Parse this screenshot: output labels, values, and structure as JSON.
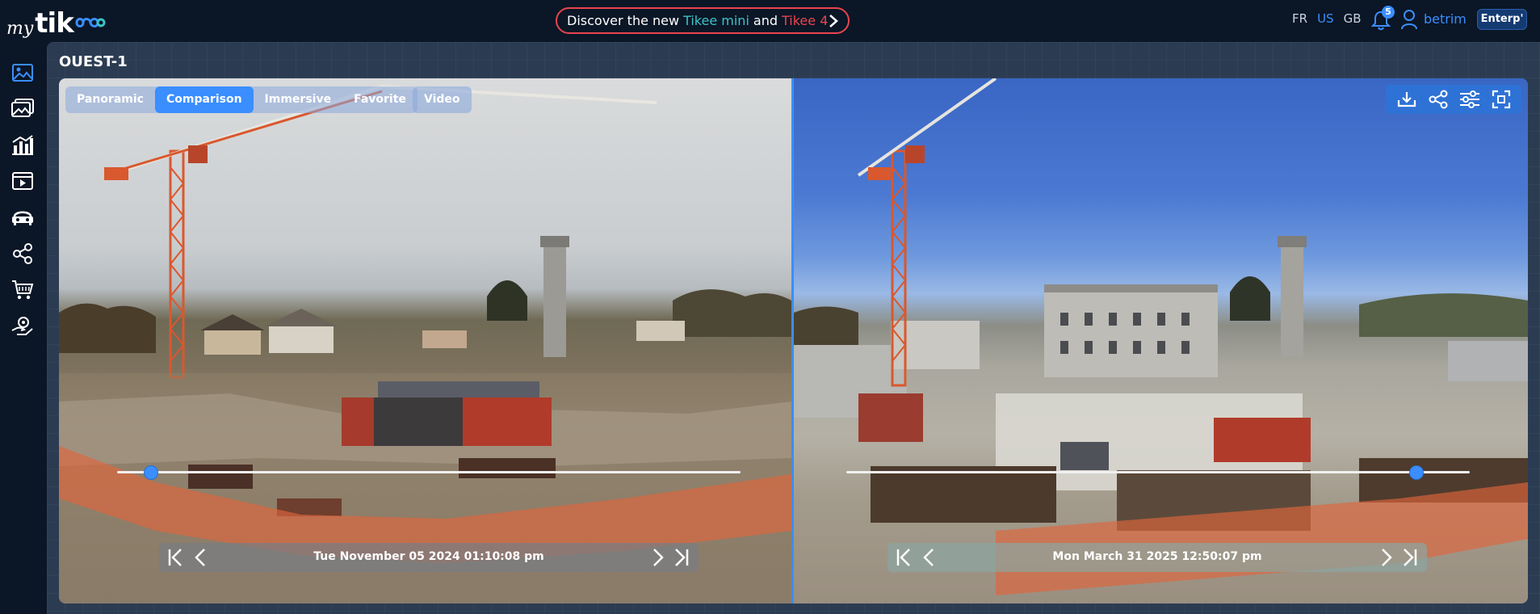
{
  "app": {
    "logo_prefix": "my",
    "logo_word": "tik"
  },
  "promo": {
    "text_before": "Discover the new",
    "product1": "Tikee mini",
    "text_and": "and",
    "product2": "Tikee 4"
  },
  "header": {
    "languages": [
      {
        "code": "FR",
        "active": false
      },
      {
        "code": "US",
        "active": true
      },
      {
        "code": "GB",
        "active": false
      }
    ],
    "notification_count": "5",
    "username": "betrim",
    "plan": "Enterp'"
  },
  "sidebar": {
    "items": [
      {
        "name": "images-icon",
        "active": true
      },
      {
        "name": "gallery-icon",
        "active": false
      },
      {
        "name": "analytics-icon",
        "active": false
      },
      {
        "name": "video-icon",
        "active": false
      },
      {
        "name": "cameras-icon",
        "active": false
      },
      {
        "name": "share-icon",
        "active": false
      },
      {
        "name": "cart-icon",
        "active": false
      },
      {
        "name": "support-icon",
        "active": false
      }
    ]
  },
  "page": {
    "title": "OUEST-1"
  },
  "viewer": {
    "mode_tabs": [
      {
        "label": "Panoramic",
        "active": false
      },
      {
        "label": "Comparison",
        "active": true
      },
      {
        "label": "Immersive",
        "active": false
      },
      {
        "label": "Favorite",
        "active": false
      }
    ],
    "video_label": "Video",
    "tools": [
      "download-icon",
      "share-icon",
      "settings-sliders-icon",
      "fullscreen-icon"
    ],
    "left": {
      "date": "Tue November 05 2024 01:10:08 pm",
      "slider_position": 0.055
    },
    "right": {
      "date": "Mon March 31 2025 12:50:07 pm",
      "slider_position": 0.915
    }
  },
  "colors": {
    "accent": "#3a8eff",
    "promo_teal": "#3bc3c8",
    "promo_red": "#e8454f",
    "background": "#0b1626"
  }
}
